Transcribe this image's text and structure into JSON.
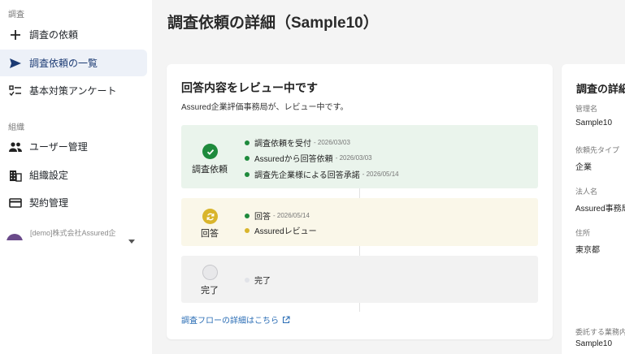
{
  "sidebar": {
    "section_survey": "調査",
    "section_org": "組織",
    "items": [
      {
        "label": "調査の依頼"
      },
      {
        "label": "調査依頼の一覧"
      },
      {
        "label": "基本対策アンケート"
      },
      {
        "label": "ユーザー管理"
      },
      {
        "label": "組織設定"
      },
      {
        "label": "契約管理"
      }
    ],
    "org_name": "[demo]株式会社Assured企"
  },
  "page": {
    "title": "調査依頼の詳細（Sample10）"
  },
  "status_card": {
    "title": "回答内容をレビュー中です",
    "subtitle": "Assured企業評価事務局が、レビュー中です。",
    "steps": [
      {
        "label": "調査依頼",
        "events": [
          {
            "text": "調査依頼を受付",
            "date": "- 2026/03/03"
          },
          {
            "text": "Assuredから回答依頼",
            "date": "- 2026/03/03"
          },
          {
            "text": "調査先企業様による回答承諾",
            "date": "- 2026/05/14"
          }
        ]
      },
      {
        "label": "回答",
        "events": [
          {
            "text": "回答",
            "date": "- 2026/05/14"
          },
          {
            "text": "Assuredレビュー",
            "date": ""
          }
        ]
      },
      {
        "label": "完了",
        "events": [
          {
            "text": "完了",
            "date": ""
          }
        ]
      }
    ],
    "flow_link": "調査フローの詳細はこちら"
  },
  "detail_card": {
    "title": "調査の詳細",
    "fields": [
      {
        "label": "管理名",
        "value": "Sample10"
      },
      {
        "label": "依頼先タイプ",
        "value": "企業"
      },
      {
        "label": "法人名",
        "value": "Assured事務局"
      },
      {
        "label": "住所",
        "value": "東京都"
      },
      {
        "label": "委託する業務内",
        "value": "Sample10"
      }
    ]
  },
  "colors": {
    "done_green": "#1e8a3c",
    "progress_yellow": "#d9b52c",
    "pending_gray": "#d6d6d6",
    "link_blue": "#2a6db5",
    "nav_active": "#1b3a73"
  }
}
